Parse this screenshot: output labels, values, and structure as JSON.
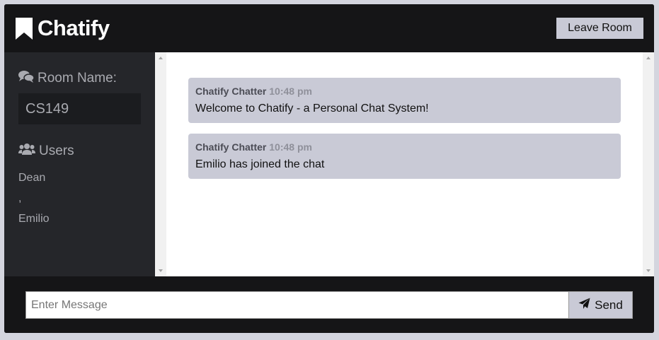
{
  "header": {
    "app_name": "Chatify",
    "leave_button": "Leave Room"
  },
  "icons": {
    "logo": "bookmark-icon",
    "room": "comments-icon",
    "users": "users-icon",
    "send": "paper-plane-icon"
  },
  "sidebar": {
    "room_heading": "Room Name:",
    "room_name": "CS149",
    "users_heading": "Users",
    "users": [
      "Dean",
      ",",
      "Emilio"
    ]
  },
  "messages": [
    {
      "author": "Chatify Chatter",
      "time": "10:48 pm",
      "text": "Welcome to Chatify - a Personal Chat System!"
    },
    {
      "author": "Chatify Chatter",
      "time": "10:48 pm",
      "text": "Emilio has joined the chat"
    }
  ],
  "composer": {
    "placeholder": "Enter Message",
    "value": "",
    "send_label": "Send"
  },
  "colors": {
    "header_bg": "#151517",
    "sidebar_bg": "#25262a",
    "message_bg": "#c9cad6",
    "button_bg": "#c9cad6"
  }
}
